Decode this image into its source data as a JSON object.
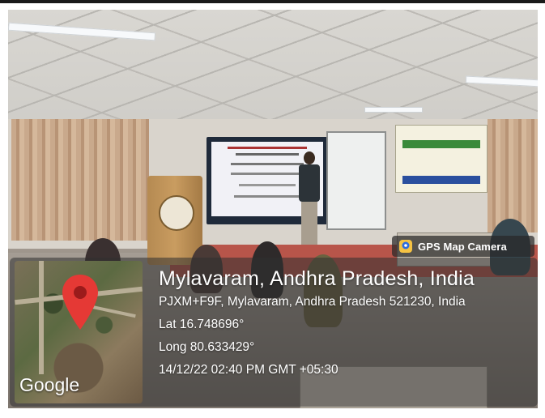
{
  "gps_badge": {
    "label": "GPS Map Camera",
    "icon": "camera-pin-icon"
  },
  "location": {
    "place": "Mylavaram, Andhra Pradesh, India",
    "address": "PJXM+F9F, Mylavaram, Andhra Pradesh 521230, India",
    "latitude": "Lat 16.748696°",
    "longitude": "Long 80.633429°",
    "datetime": "14/12/22 02:40 PM GMT +05:30"
  },
  "map": {
    "attribution": "Google",
    "pin_icon": "map-pin-icon",
    "pin_color": "#e53935"
  },
  "scene": {
    "banner_colors": {
      "green": "#3a8a3a",
      "blue": "#2a4f9e"
    }
  }
}
